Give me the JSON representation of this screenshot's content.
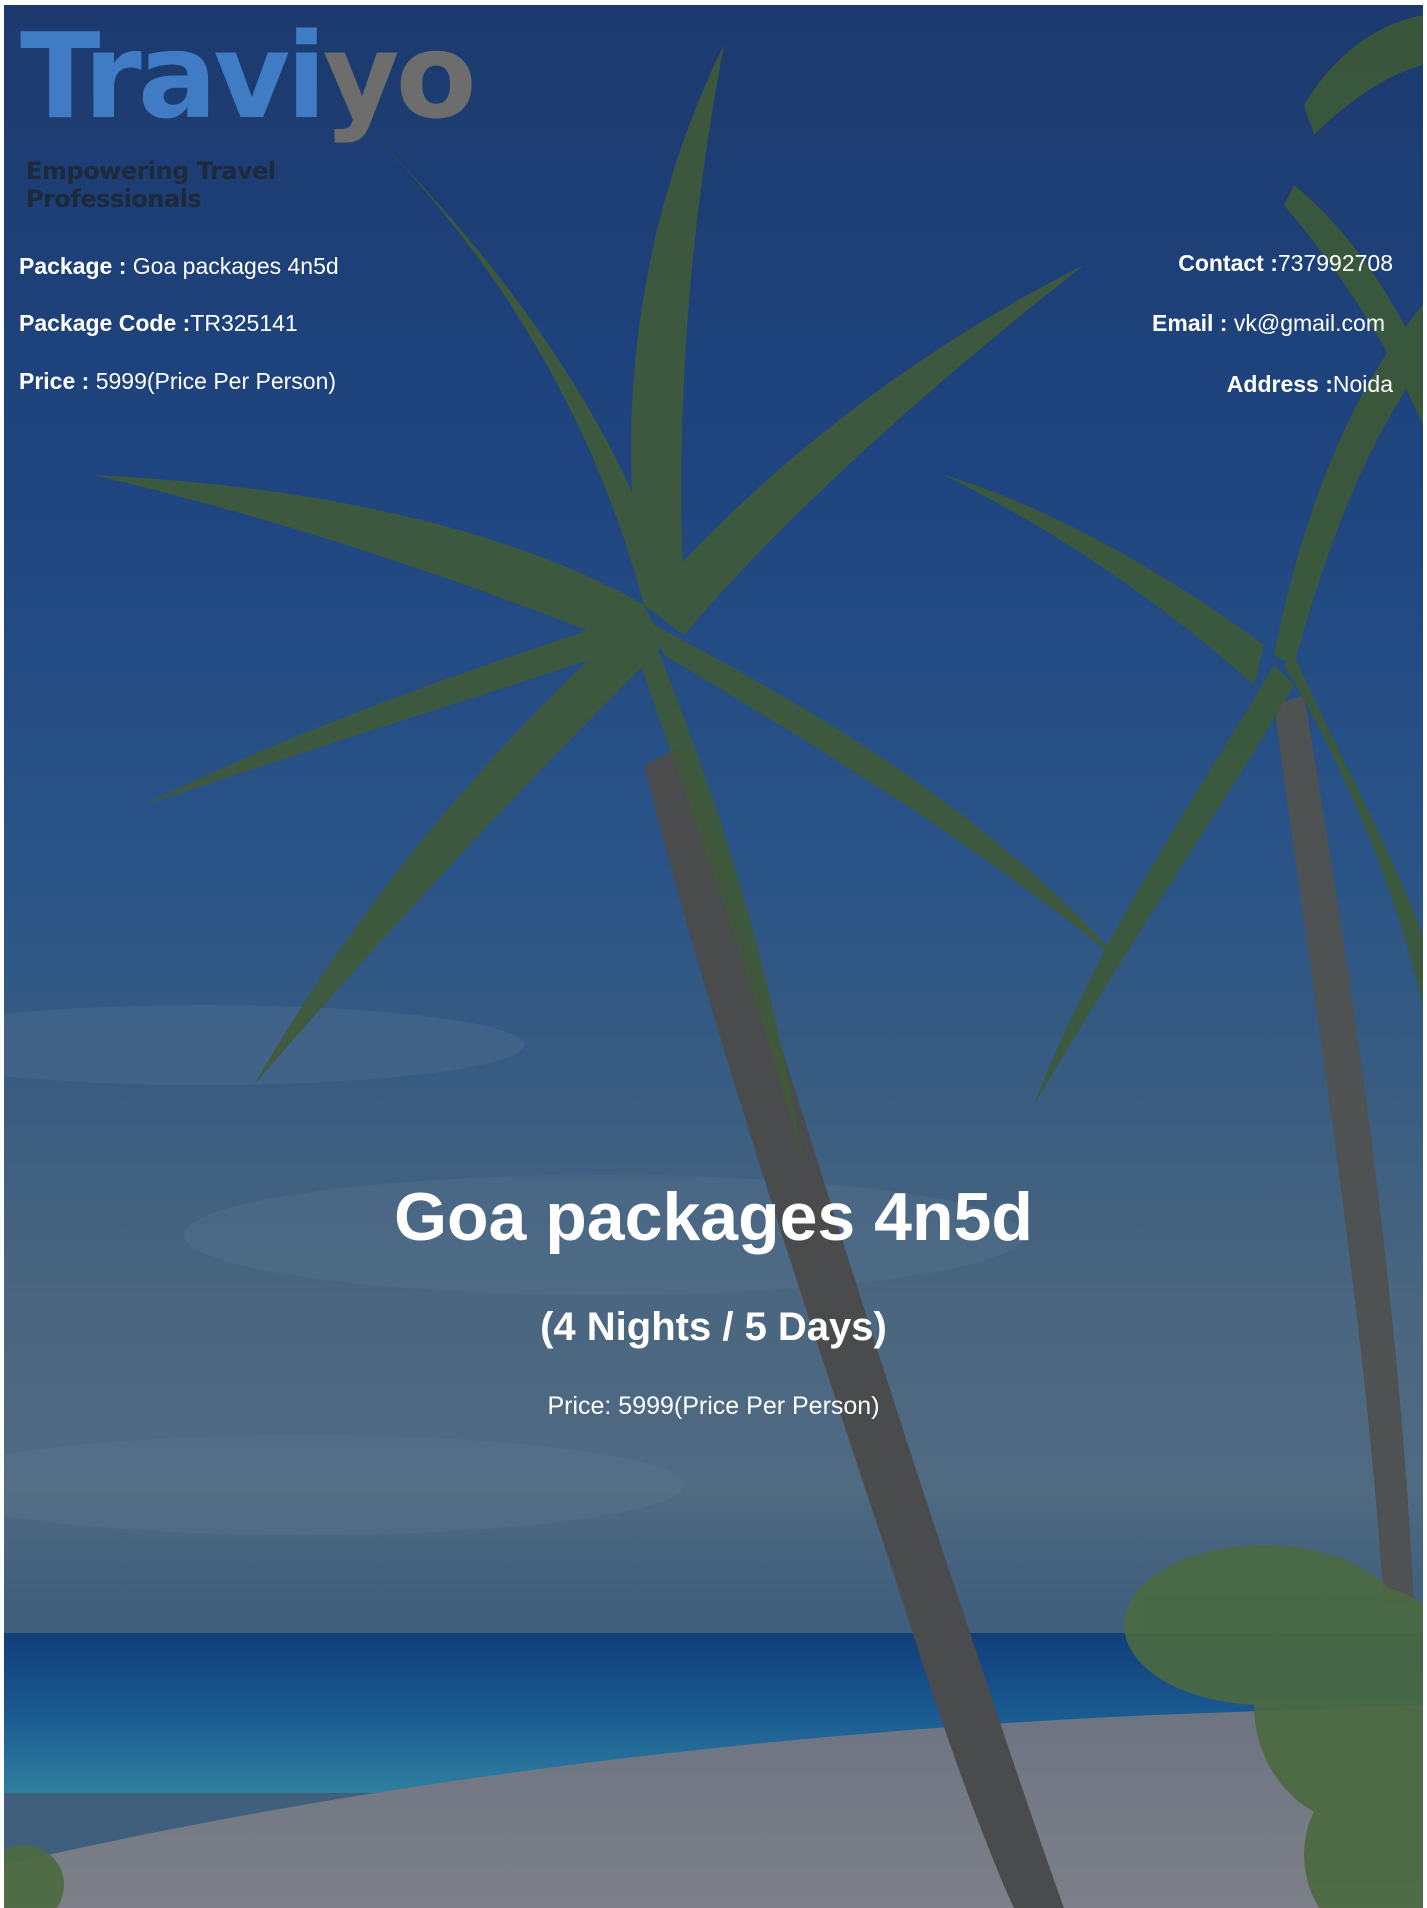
{
  "brand": {
    "logo_text_primary": "Travi",
    "logo_text_secondary": "yo",
    "tagline": "Empowering Travel Professionals"
  },
  "package_info": {
    "package_label": "Package :",
    "package_value": "Goa packages 4n5d",
    "code_label": "Package Code :",
    "code_value": "TR325141",
    "price_label": "Price :",
    "price_value": "5999(Price Per Person)"
  },
  "contact_info": {
    "contact_label": "Contact :",
    "contact_value": "737992708",
    "email_label": "Email :",
    "email_value": "vk@gmail.com",
    "address_label": "Address :",
    "address_value": "Noida"
  },
  "hero": {
    "title": "Goa packages 4n5d",
    "duration": "(4 Nights / 5 Days)",
    "price_line": "Price: 5999(Price Per Person)"
  },
  "colors": {
    "logo_blue": "#3f7cc4",
    "logo_grey": "#6d6d6d",
    "text": "#ffffff",
    "overlay": "#1c3a6e"
  }
}
